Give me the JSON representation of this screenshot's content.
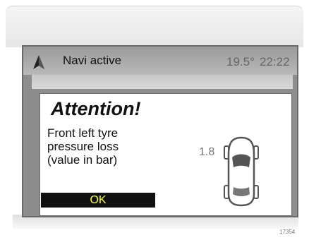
{
  "status_bar": {
    "navi_label": "Navi active",
    "temperature": "19.5°",
    "time": "22:22",
    "nav_icon": "navigation-arrow-icon"
  },
  "dialog": {
    "title": "Attention!",
    "message_lines": [
      "Front left tyre",
      "pressure loss",
      "(value in bar)"
    ],
    "pressure_value": "1.8",
    "car_icon": "car-top-view-icon",
    "ok_label": "OK"
  },
  "footer": {
    "image_id": "17354"
  },
  "colors": {
    "ok_text": "#ffff33",
    "ok_background": "#111111",
    "screen_background": "#8d8d8d"
  }
}
